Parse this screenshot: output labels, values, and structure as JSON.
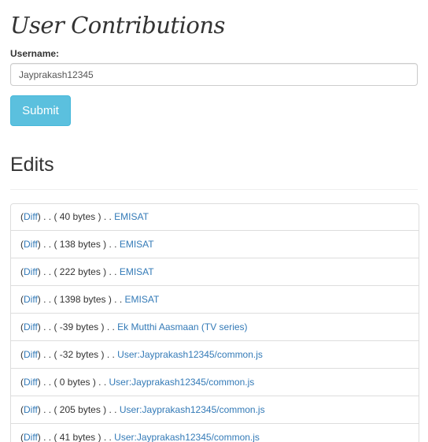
{
  "page": {
    "title": "User Contributions"
  },
  "form": {
    "username_label": "Username:",
    "username_value": "Jayprakash12345",
    "submit_label": "Submit"
  },
  "edits": {
    "heading": "Edits",
    "items": [
      {
        "diff_label": "Diff",
        "bytes": "40 bytes",
        "page": "EMISAT"
      },
      {
        "diff_label": "Diff",
        "bytes": "138 bytes",
        "page": "EMISAT"
      },
      {
        "diff_label": "Diff",
        "bytes": "222 bytes",
        "page": "EMISAT"
      },
      {
        "diff_label": "Diff",
        "bytes": "1398 bytes",
        "page": "EMISAT"
      },
      {
        "diff_label": "Diff",
        "bytes": "-39 bytes",
        "page": "Ek Mutthi Aasmaan (TV series)"
      },
      {
        "diff_label": "Diff",
        "bytes": "-32 bytes",
        "page": "User:Jayprakash12345/common.js"
      },
      {
        "diff_label": "Diff",
        "bytes": "0 bytes",
        "page": "User:Jayprakash12345/common.js"
      },
      {
        "diff_label": "Diff",
        "bytes": "205 bytes",
        "page": "User:Jayprakash12345/common.js"
      },
      {
        "diff_label": "Diff",
        "bytes": "41 bytes",
        "page": "User:Jayprakash12345/common.js"
      }
    ]
  },
  "colors": {
    "link": "#337ab7",
    "button": "#5bc0de",
    "text": "#333333"
  }
}
